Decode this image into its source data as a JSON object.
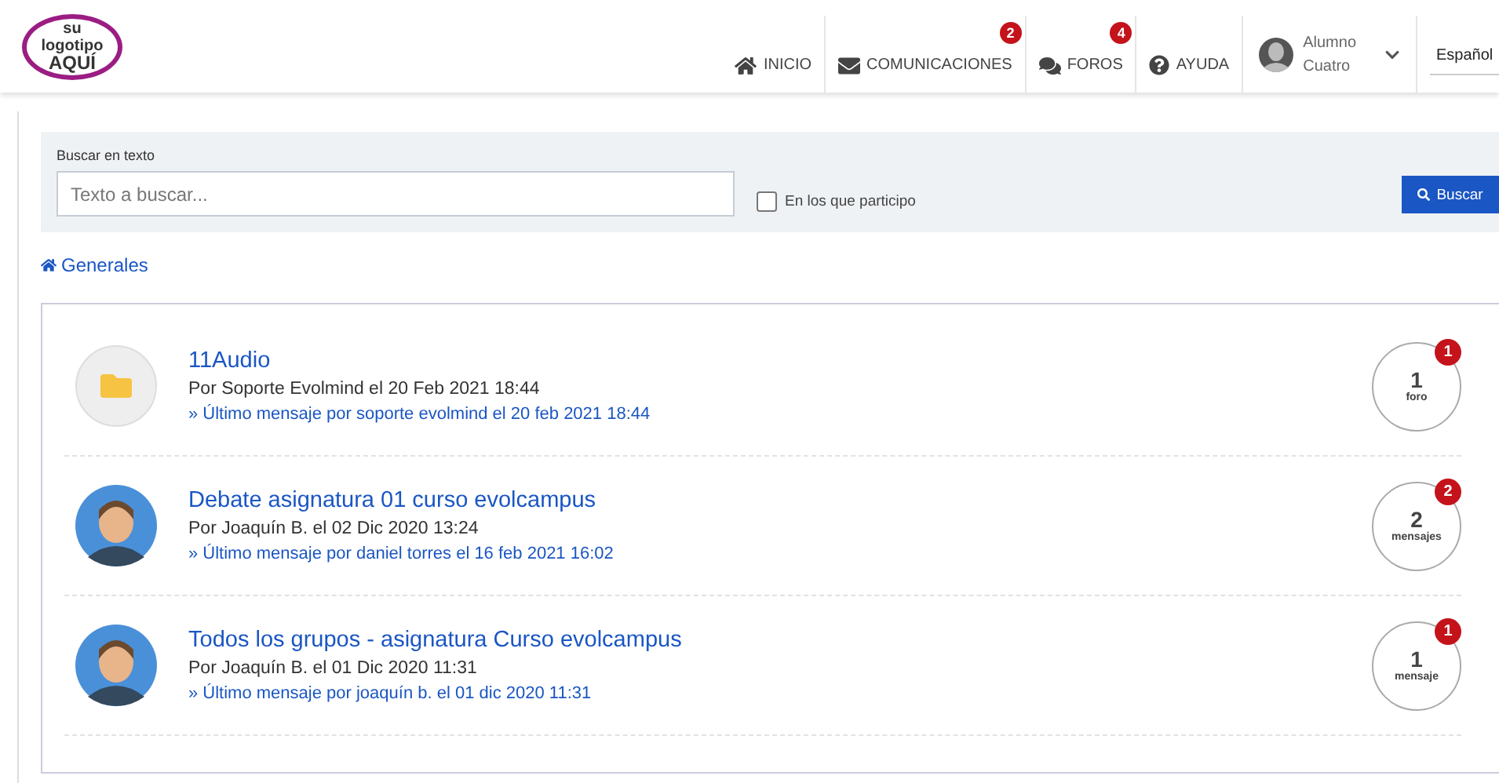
{
  "header": {
    "logo": [
      "su",
      "logotipo",
      "AQUÍ"
    ],
    "nav": [
      {
        "label": "INICIO",
        "kind": "home"
      },
      {
        "label": "COMUNICACIONES",
        "kind": "mail",
        "badge": "2"
      },
      {
        "label": "FOROS",
        "kind": "chat",
        "badge": "4"
      },
      {
        "label": "AYUDA",
        "kind": "help"
      }
    ],
    "user": {
      "name": [
        "Alumno",
        "Cuatro"
      ]
    },
    "language": {
      "value": "Español"
    }
  },
  "search": {
    "label": "Buscar en texto",
    "placeholder": "Texto a buscar...",
    "filter": {
      "label": "En los que participo",
      "checked": false
    },
    "button": "Buscar"
  },
  "breadcrumb": "Generales",
  "forums": [
    {
      "kind": "folder",
      "title": "11Audio",
      "author": "Por Soporte Evolmind el 20 Feb 2021 18:44",
      "last": "» Último mensaje por soporte evolmind el 20 feb 2021 18:44",
      "count": "1",
      "unit": "foro",
      "badge": "1"
    },
    {
      "kind": "avatar",
      "title": "Debate asignatura 01 curso evolcampus",
      "author": "Por Joaquín B. el 02 Dic 2020 13:24",
      "last": "» Último mensaje por daniel torres el 16 feb 2021 16:02",
      "count": "2",
      "unit": "mensajes",
      "badge": "2"
    },
    {
      "kind": "avatar",
      "title": "Todos los grupos - asignatura Curso evolcampus",
      "author": "Por Joaquín B. el 01 Dic 2020 11:31",
      "last": "» Último mensaje por joaquín b. el 01 dic 2020 11:31",
      "count": "1",
      "unit": "mensaje",
      "badge": "1"
    }
  ]
}
